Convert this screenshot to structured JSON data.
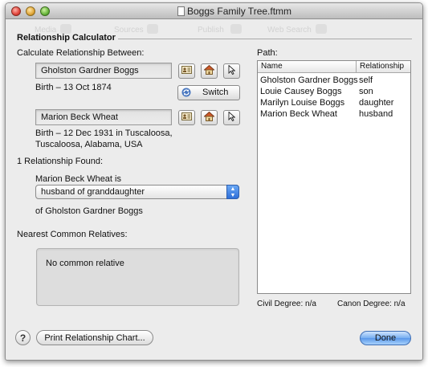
{
  "window": {
    "title": "Boggs Family Tree.ftmm"
  },
  "toolbar_ghost": [
    "Media",
    "Sources",
    "Publish",
    "Web Search"
  ],
  "section_title": "Relationship Calculator",
  "calc_label": "Calculate Relationship Between:",
  "person1": {
    "name": "Gholston Gardner Boggs",
    "birth": "Birth – 13 Oct 1874"
  },
  "switch_label": "Switch",
  "person2": {
    "name": "Marion Beck Wheat",
    "birth_line1": "Birth – 12 Dec 1931 in Tuscaloosa,",
    "birth_line2": "Tuscaloosa, Alabama, USA"
  },
  "found_label": "1 Relationship Found:",
  "relation_subject": "Marion Beck Wheat is",
  "relation_selected": "husband of granddaughter",
  "relation_object": "of Gholston Gardner Boggs",
  "common_label": "Nearest Common Relatives:",
  "common_value": "No common relative",
  "path": {
    "label": "Path:",
    "columns": [
      "Name",
      "Relationship"
    ],
    "rows": [
      [
        "Gholston Gardner Boggs",
        "self"
      ],
      [
        "Louie Causey Boggs",
        "son"
      ],
      [
        "Marilyn Louise Boggs",
        "daughter"
      ],
      [
        "Marion Beck Wheat",
        "husband"
      ]
    ]
  },
  "degrees": {
    "civil": "Civil Degree:  n/a",
    "canon": "Canon Degree:  n/a"
  },
  "footer": {
    "help": "?",
    "print": "Print Relationship Chart...",
    "done": "Done"
  },
  "icons": [
    "person-card-icon",
    "home-icon",
    "pointer-icon",
    "switch-icon",
    "help-icon"
  ],
  "colors": {
    "accent": "#5a98ea",
    "window_bg": "#ececec"
  }
}
